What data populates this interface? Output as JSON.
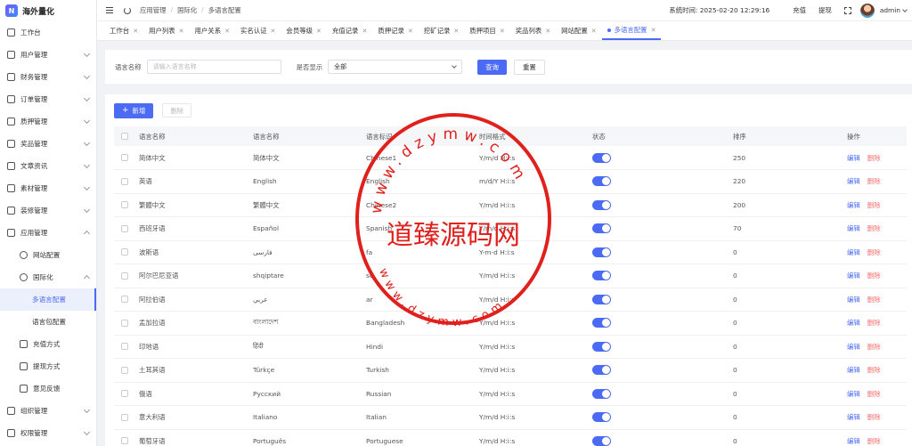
{
  "app": {
    "title": "海外量化",
    "logo_letter": "N"
  },
  "sidebar": {
    "items": [
      {
        "label": "工作台",
        "icon": "dashboard-icon",
        "level": 0,
        "chevron": ""
      },
      {
        "label": "用户管理",
        "icon": "user-icon",
        "level": 0,
        "chevron": "down"
      },
      {
        "label": "财务管理",
        "icon": "finance-icon",
        "level": 0,
        "chevron": "down"
      },
      {
        "label": "订单管理",
        "icon": "order-icon",
        "level": 0,
        "chevron": "down"
      },
      {
        "label": "质押管理",
        "icon": "pledge-icon",
        "level": 0,
        "chevron": "down"
      },
      {
        "label": "奖品管理",
        "icon": "prize-icon",
        "level": 0,
        "chevron": "down"
      },
      {
        "label": "文章资讯",
        "icon": "article-icon",
        "level": 0,
        "chevron": "down"
      },
      {
        "label": "素材管理",
        "icon": "material-icon",
        "level": 0,
        "chevron": "down"
      },
      {
        "label": "装修管理",
        "icon": "decor-icon",
        "level": 0,
        "chevron": "down"
      },
      {
        "label": "应用管理",
        "icon": "app-icon",
        "level": 0,
        "chevron": "up"
      },
      {
        "label": "网站配置",
        "icon": "globe-icon",
        "level": 1,
        "chevron": ""
      },
      {
        "label": "国际化",
        "icon": "globe-icon",
        "level": 1,
        "chevron": "up"
      },
      {
        "label": "多语言配置",
        "icon": "",
        "level": 2,
        "chevron": "",
        "active": true
      },
      {
        "label": "语言包配置",
        "icon": "",
        "level": 2,
        "chevron": ""
      },
      {
        "label": "充值方式",
        "icon": "recharge-icon",
        "level": 1,
        "chevron": ""
      },
      {
        "label": "提现方式",
        "icon": "withdraw-icon",
        "level": 1,
        "chevron": ""
      },
      {
        "label": "意见反馈",
        "icon": "feedback-icon",
        "level": 1,
        "chevron": ""
      },
      {
        "label": "组织管理",
        "icon": "org-icon",
        "level": 0,
        "chevron": "down"
      },
      {
        "label": "权限管理",
        "icon": "permission-icon",
        "level": 0,
        "chevron": "down"
      }
    ]
  },
  "header": {
    "breadcrumbs": [
      "应用管理",
      "国际化",
      "多语言配置"
    ],
    "sys_time": "系统时间: 2025-02-20 12:29:16",
    "recharge": "充值",
    "withdraw": "提现",
    "username": "admin"
  },
  "tabs": [
    {
      "label": "工作台",
      "active": false
    },
    {
      "label": "用户列表",
      "active": false
    },
    {
      "label": "用户关系",
      "active": false
    },
    {
      "label": "实名认证",
      "active": false
    },
    {
      "label": "会员等级",
      "active": false
    },
    {
      "label": "充值记录",
      "active": false
    },
    {
      "label": "质押记录",
      "active": false
    },
    {
      "label": "挖矿记录",
      "active": false
    },
    {
      "label": "质押项目",
      "active": false
    },
    {
      "label": "奖品列表",
      "active": false
    },
    {
      "label": "网站配置",
      "active": false
    },
    {
      "label": "多语言配置",
      "active": true
    }
  ],
  "filter": {
    "name_label": "语言名称",
    "name_placeholder": "请输入语言名称",
    "show_label": "是否显示",
    "show_value": "全部",
    "query": "查询",
    "reset": "重置"
  },
  "toolbar": {
    "add": "新增",
    "delete": "删除"
  },
  "table": {
    "columns": [
      "语言名称",
      "语言名称",
      "语言标识",
      "时间格式",
      "状态",
      "排序",
      "操作"
    ],
    "edit_label": "编辑",
    "delete_label": "删除",
    "rows": [
      [
        "简体中文",
        "简体中文",
        "Chinese1",
        "Y/m/d H:i:s",
        "250"
      ],
      [
        "英语",
        "English",
        "English",
        "m/d/Y H:i:s",
        "220"
      ],
      [
        "繁體中文",
        "繁體中文",
        "Chinese2",
        "Y/m/d H:i:s",
        "200"
      ],
      [
        "西班牙语",
        "Español",
        "Spanish",
        "Y/m/d H:i:s",
        "70"
      ],
      [
        "波斯语",
        "فارسی",
        "fa",
        "Y-m-d H:i:s",
        "0"
      ],
      [
        "阿尔巴尼亚语",
        "shqiptare",
        "sq",
        "Y/m/d H:i:s",
        "0"
      ],
      [
        "阿拉伯语",
        "عربي",
        "ar",
        "Y/m/d H:i:s",
        "0"
      ],
      [
        "孟加拉语",
        "বাংলাদেশ",
        "Bangladesh",
        "Y/m/d H:i:s",
        "0"
      ],
      [
        "印地语",
        "हिंदी",
        "Hindi",
        "Y/m/d H:i:s",
        "0"
      ],
      [
        "土耳其语",
        "Türkçe",
        "Turkish",
        "Y/m/d H:i:s",
        "0"
      ],
      [
        "俄语",
        "Русский",
        "Russian",
        "Y/m/d H:i:s",
        "0"
      ],
      [
        "意大利语",
        "Italiano",
        "Italian",
        "Y/m/d H:i:s",
        "0"
      ],
      [
        "葡萄牙语",
        "Português",
        "Portuguese",
        "Y/m/d H:i:s",
        "0"
      ]
    ]
  },
  "watermark": {
    "center_text": "道臻源码网",
    "ring_text": "www.dzymw.com"
  },
  "colors": {
    "accent": "#4b6bf5",
    "danger": "#f56c6c",
    "stamp": "#e0201c"
  }
}
